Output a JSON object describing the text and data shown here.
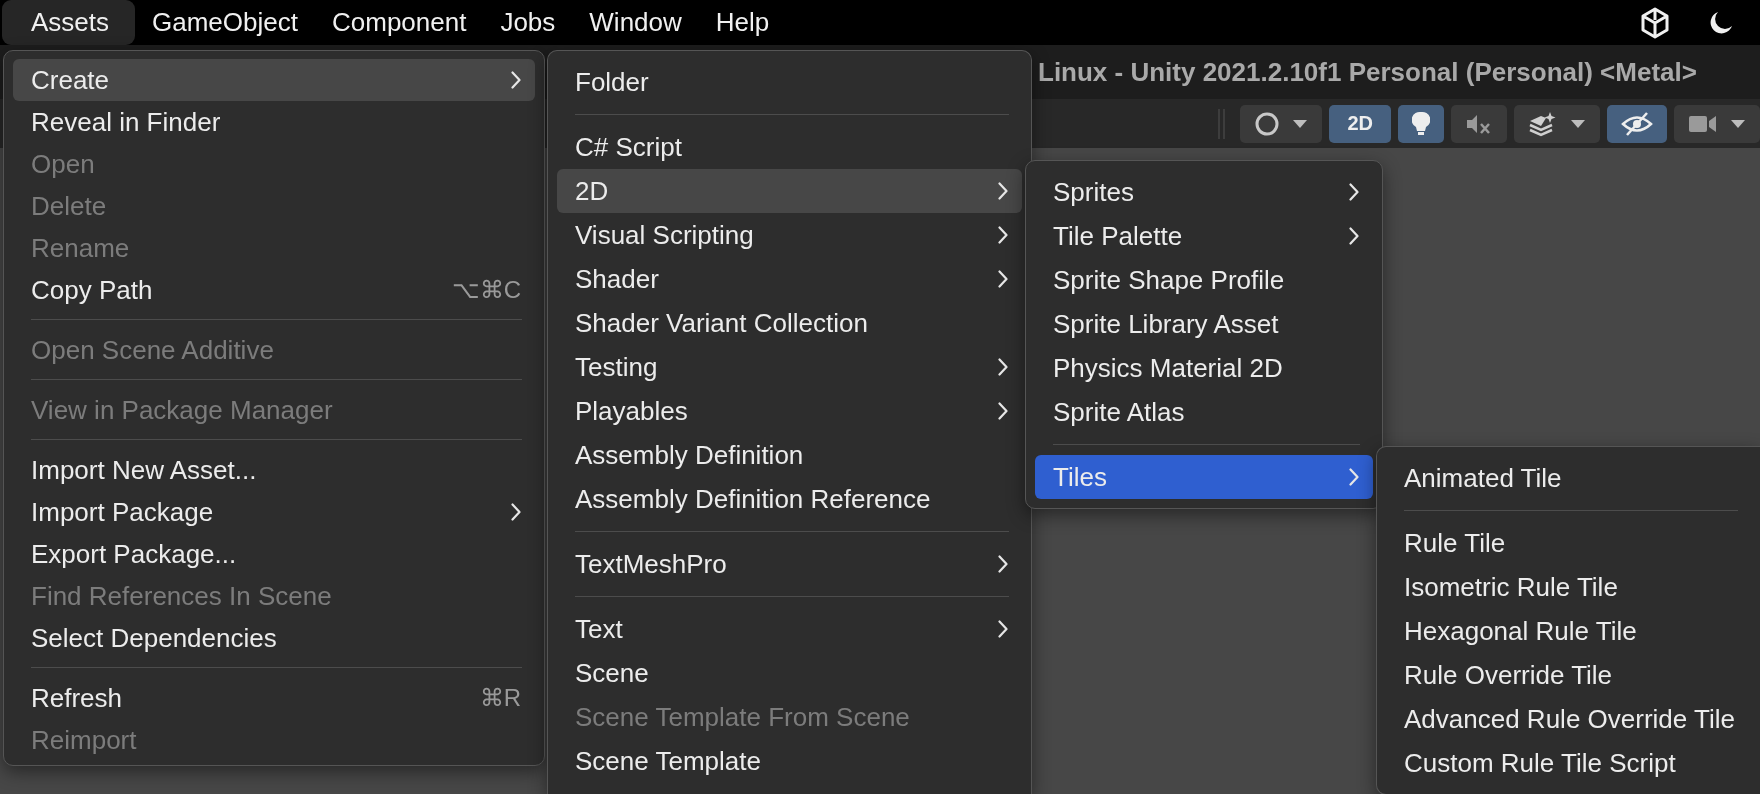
{
  "menu_bar": {
    "items": [
      {
        "label": "Assets",
        "selected": true
      },
      {
        "label": "GameObject",
        "selected": false
      },
      {
        "label": "Component",
        "selected": false
      },
      {
        "label": "Jobs",
        "selected": false
      },
      {
        "label": "Window",
        "selected": false
      },
      {
        "label": "Help",
        "selected": false
      }
    ]
  },
  "window": {
    "title": "Linux - Unity 2021.2.10f1 Personal (Personal) <Metal>"
  },
  "toolbar": {
    "buttons": [
      {
        "kind": "shading",
        "on": false
      },
      {
        "kind": "text",
        "label": "2D",
        "on": true
      },
      {
        "kind": "light",
        "on": true
      },
      {
        "kind": "audio",
        "on": false
      },
      {
        "kind": "effects",
        "on": false
      },
      {
        "kind": "visibility",
        "on": true
      },
      {
        "kind": "camera",
        "on": false
      }
    ]
  },
  "menus": [
    {
      "items": [
        {
          "kind": "item",
          "label": "Create",
          "submenu": true,
          "selected": true,
          "disabled": false
        },
        {
          "kind": "item",
          "label": "Reveal in Finder",
          "submenu": false,
          "selected": false,
          "disabled": false
        },
        {
          "kind": "item",
          "label": "Open",
          "submenu": false,
          "selected": false,
          "disabled": true
        },
        {
          "kind": "item",
          "label": "Delete",
          "submenu": false,
          "selected": false,
          "disabled": true
        },
        {
          "kind": "item",
          "label": "Rename",
          "submenu": false,
          "selected": false,
          "disabled": true
        },
        {
          "kind": "item",
          "label": "Copy Path",
          "shortcut": "⌥⌘C",
          "submenu": false,
          "selected": false,
          "disabled": false
        },
        {
          "kind": "separator"
        },
        {
          "kind": "item",
          "label": "Open Scene Additive",
          "submenu": false,
          "selected": false,
          "disabled": true
        },
        {
          "kind": "separator"
        },
        {
          "kind": "item",
          "label": "View in Package Manager",
          "submenu": false,
          "selected": false,
          "disabled": true
        },
        {
          "kind": "separator"
        },
        {
          "kind": "item",
          "label": "Import New Asset...",
          "submenu": false,
          "selected": false,
          "disabled": false
        },
        {
          "kind": "item",
          "label": "Import Package",
          "submenu": true,
          "selected": false,
          "disabled": false
        },
        {
          "kind": "item",
          "label": "Export Package...",
          "submenu": false,
          "selected": false,
          "disabled": false
        },
        {
          "kind": "item",
          "label": "Find References In Scene",
          "submenu": false,
          "selected": false,
          "disabled": true
        },
        {
          "kind": "item",
          "label": "Select Dependencies",
          "submenu": false,
          "selected": false,
          "disabled": false
        },
        {
          "kind": "separator"
        },
        {
          "kind": "item",
          "label": "Refresh",
          "shortcut": "⌘R",
          "submenu": false,
          "selected": false,
          "disabled": false
        },
        {
          "kind": "item",
          "label": "Reimport",
          "submenu": false,
          "selected": false,
          "disabled": true
        }
      ]
    },
    {
      "items": [
        {
          "kind": "item",
          "label": "Folder",
          "submenu": false,
          "selected": false,
          "disabled": false
        },
        {
          "kind": "separator"
        },
        {
          "kind": "item",
          "label": "C# Script",
          "submenu": false,
          "selected": false,
          "disabled": false
        },
        {
          "kind": "item",
          "label": "2D",
          "submenu": true,
          "selected": true,
          "disabled": false
        },
        {
          "kind": "item",
          "label": "Visual Scripting",
          "submenu": true,
          "selected": false,
          "disabled": false
        },
        {
          "kind": "item",
          "label": "Shader",
          "submenu": true,
          "selected": false,
          "disabled": false
        },
        {
          "kind": "item",
          "label": "Shader Variant Collection",
          "submenu": false,
          "selected": false,
          "disabled": false
        },
        {
          "kind": "item",
          "label": "Testing",
          "submenu": true,
          "selected": false,
          "disabled": false
        },
        {
          "kind": "item",
          "label": "Playables",
          "submenu": true,
          "selected": false,
          "disabled": false
        },
        {
          "kind": "item",
          "label": "Assembly Definition",
          "submenu": false,
          "selected": false,
          "disabled": false
        },
        {
          "kind": "item",
          "label": "Assembly Definition Reference",
          "submenu": false,
          "selected": false,
          "disabled": false
        },
        {
          "kind": "separator"
        },
        {
          "kind": "item",
          "label": "TextMeshPro",
          "submenu": true,
          "selected": false,
          "disabled": false
        },
        {
          "kind": "separator"
        },
        {
          "kind": "item",
          "label": "Text",
          "submenu": true,
          "selected": false,
          "disabled": false
        },
        {
          "kind": "item",
          "label": "Scene",
          "submenu": false,
          "selected": false,
          "disabled": false
        },
        {
          "kind": "item",
          "label": "Scene Template From Scene",
          "submenu": false,
          "selected": false,
          "disabled": true
        },
        {
          "kind": "item",
          "label": "Scene Template",
          "submenu": false,
          "selected": false,
          "disabled": false
        }
      ]
    },
    {
      "items": [
        {
          "kind": "item",
          "label": "Sprites",
          "submenu": true,
          "selected": false,
          "disabled": false
        },
        {
          "kind": "item",
          "label": "Tile Palette",
          "submenu": true,
          "selected": false,
          "disabled": false
        },
        {
          "kind": "item",
          "label": "Sprite Shape Profile",
          "submenu": false,
          "selected": false,
          "disabled": false
        },
        {
          "kind": "item",
          "label": "Sprite Library Asset",
          "submenu": false,
          "selected": false,
          "disabled": false
        },
        {
          "kind": "item",
          "label": "Physics Material 2D",
          "submenu": false,
          "selected": false,
          "disabled": false
        },
        {
          "kind": "item",
          "label": "Sprite Atlas",
          "submenu": false,
          "selected": false,
          "disabled": false
        },
        {
          "kind": "separator"
        },
        {
          "kind": "item",
          "label": "Tiles",
          "submenu": true,
          "selected": true,
          "disabled": false
        }
      ]
    },
    {
      "items": [
        {
          "kind": "item",
          "label": "Animated Tile",
          "submenu": false,
          "selected": false,
          "disabled": false
        },
        {
          "kind": "separator"
        },
        {
          "kind": "item",
          "label": "Rule Tile",
          "submenu": false,
          "selected": false,
          "disabled": false
        },
        {
          "kind": "item",
          "label": "Isometric Rule Tile",
          "submenu": false,
          "selected": false,
          "disabled": false
        },
        {
          "kind": "item",
          "label": "Hexagonal Rule Tile",
          "submenu": false,
          "selected": false,
          "disabled": false
        },
        {
          "kind": "item",
          "label": "Rule Override Tile",
          "submenu": false,
          "selected": false,
          "disabled": false
        },
        {
          "kind": "item",
          "label": "Advanced Rule Override Tile",
          "submenu": false,
          "selected": false,
          "disabled": false
        },
        {
          "kind": "item",
          "label": "Custom Rule Tile Script",
          "submenu": false,
          "selected": false,
          "disabled": false
        }
      ]
    }
  ]
}
